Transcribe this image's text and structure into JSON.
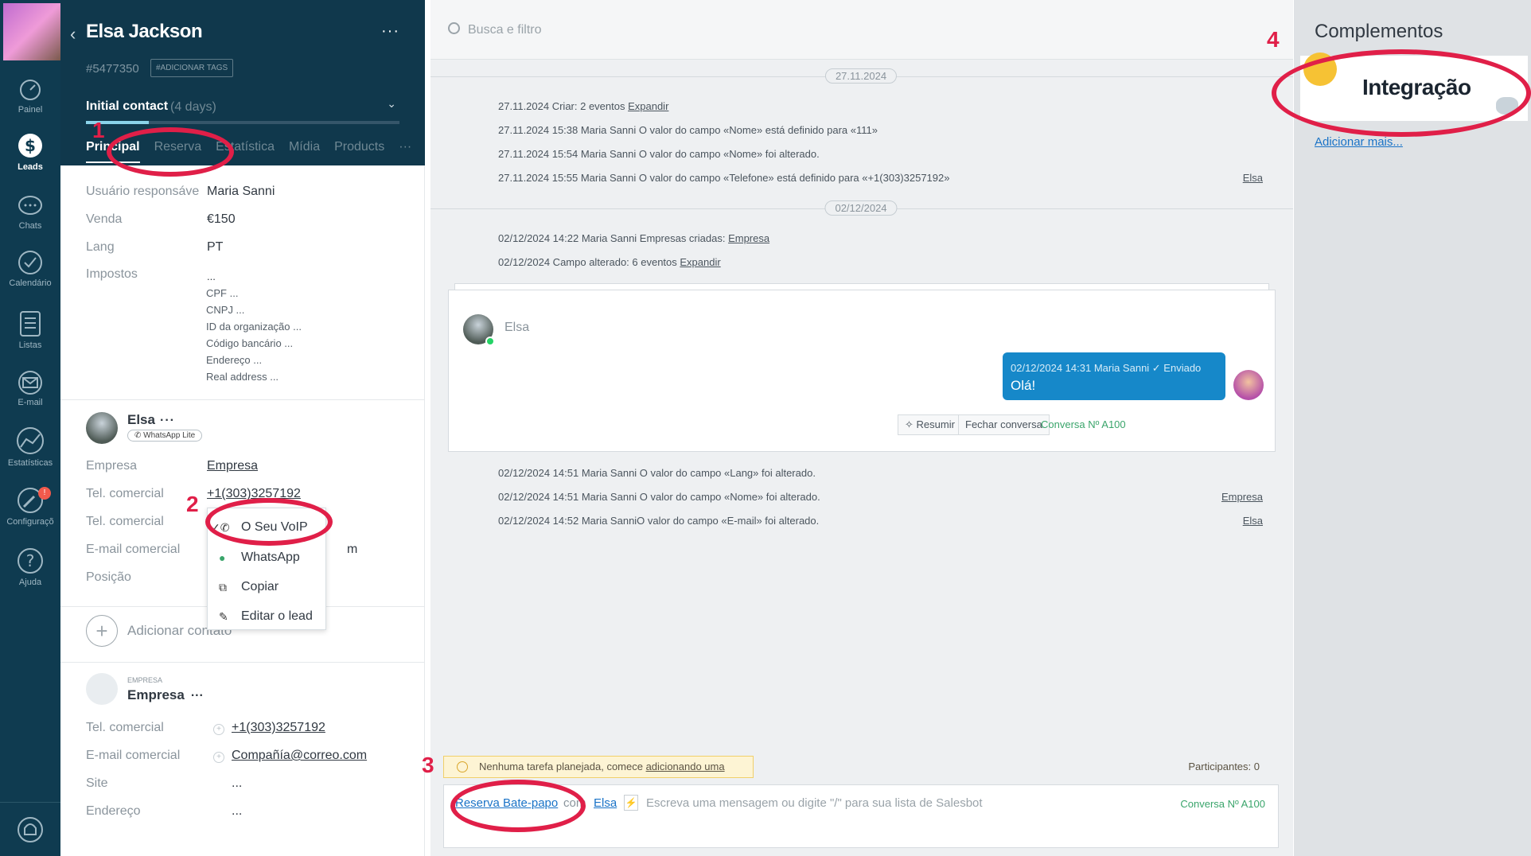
{
  "nav": {
    "items": [
      {
        "label": "Painel",
        "icon": "dashboard-icon"
      },
      {
        "label": "Leads",
        "icon": "leads-icon",
        "active": true
      },
      {
        "label": "Chats",
        "icon": "chat-icon"
      },
      {
        "label": "Calendário",
        "icon": "check-icon"
      },
      {
        "label": "Listas",
        "icon": "list-icon"
      },
      {
        "label": "E-mail",
        "icon": "mail-icon"
      },
      {
        "label": "Estatísticas",
        "icon": "stats-icon"
      },
      {
        "label": "Configuraçõ",
        "icon": "settings-icon",
        "badge": "!"
      },
      {
        "label": "Ajuda",
        "icon": "help-icon"
      }
    ]
  },
  "lead": {
    "name": "Elsa Jackson",
    "more": "···",
    "id": "#5477350",
    "add_tags": "#ADICIONAR TAGS",
    "stage": "Initial contact",
    "stage_days": "(4 days)",
    "stage_progress": 0.2,
    "tabs": [
      "Principal",
      "Reserva",
      "Estatística",
      "Mídia",
      "Products",
      "···"
    ],
    "fields": [
      {
        "label": "Usuário responsáve",
        "value": "Maria Sanni"
      },
      {
        "label": "Venda",
        "value": "€150"
      },
      {
        "label": "Lang",
        "value": "PT"
      },
      {
        "label": "Impostos",
        "value": "..."
      }
    ],
    "tax_list": [
      "CPF ...",
      "CNPJ ...",
      "ID da organização ...",
      "Código bancário ...",
      "Endereço ...",
      "Real address ..."
    ]
  },
  "contact": {
    "name": "Elsa",
    "more": "···",
    "chip": "WhatsApp Lite",
    "fields": [
      {
        "label": "Empresa",
        "value": "Empresa"
      },
      {
        "label": "Tel. comercial",
        "value": "+1(303)3257192"
      },
      {
        "label": "Tel. comercial",
        "value": ""
      },
      {
        "label": "E-mail comercial",
        "value": "m"
      },
      {
        "label": "Posição",
        "value": ""
      }
    ],
    "add_label": "Adicionar contato"
  },
  "menu": {
    "items": [
      {
        "label": "O Seu VoIP",
        "icon": "✓📞"
      },
      {
        "label": "WhatsApp",
        "icon": "●"
      },
      {
        "label": "Copiar",
        "icon": "⧉"
      },
      {
        "label": "Editar o lead",
        "icon": "✎"
      }
    ]
  },
  "company": {
    "kind": "EMPRESA",
    "name": "Empresa",
    "more": "···",
    "fields": [
      {
        "label": "Tel. comercial",
        "value": "+1(303)3257192"
      },
      {
        "label": "E-mail comercial",
        "value": "Compañía@correo.com"
      },
      {
        "label": "Site",
        "value": "..."
      },
      {
        "label": "Endereço",
        "value": "..."
      }
    ]
  },
  "feed": {
    "search_placeholder": "Busca e filtro",
    "date1": "27.11.2024",
    "date2": "02/12/2024",
    "events1": [
      {
        "text": "27.11.2024 Criar: 2 eventos ",
        "link": "Expandir"
      },
      {
        "text": "27.11.2024 15:38 Maria Sanni O valor do campo «Nome» está definido para «111»",
        "link": ""
      },
      {
        "text": "27.11.2024 15:54 Maria Sanni O valor do campo «Nome» foi alterado.",
        "link": ""
      },
      {
        "text": "27.11.2024 15:55 Maria Sanni O valor do campo «Telefone» está definido para «+1(303)3257192»",
        "link": "",
        "right": "Elsa"
      }
    ],
    "events2": [
      {
        "text": "02/12/2024 14:22 Maria Sanni Empresas criadas: ",
        "link": "Empresa"
      },
      {
        "text": "02/12/2024 Campo alterado: 6 eventos ",
        "link": "Expandir"
      }
    ],
    "chat": {
      "from": "Elsa",
      "bubble_meta": "02/12/2024 14:31 Maria Sanni ✓ Enviado",
      "bubble_text": "Olá!",
      "btn_summarize": "Resumir",
      "btn_close": "Fechar conversa",
      "conversation": "Conversa Nº A100"
    },
    "events3": [
      {
        "text": "02/12/2024 14:51 Maria Sanni O valor do campo «Lang» foi alterado.",
        "right": ""
      },
      {
        "text": "02/12/2024 14:51 Maria Sanni O valor do campo «Nome» foi alterado.",
        "right": "Empresa"
      },
      {
        "text": "02/12/2024 14:52 Maria SanniO valor do campo «E-mail» foi alterado.",
        "right": "Elsa"
      }
    ],
    "task_warning": "Nenhuma tarefa planejada, comece ",
    "task_link": "adicionando uma",
    "participants": "Participantes: 0",
    "composer": {
      "reserve_link": "Reserva Bate-papo",
      "with": "com",
      "contact_link": "Elsa",
      "colon": ":",
      "placeholder": "Escreva uma mensagem ou digite \"/\" para sua lista de Salesbot",
      "conversation": "Conversa Nº A100"
    }
  },
  "right_panel": {
    "title": "Complementos",
    "card_title": "Integração",
    "more_link": "Adicionar mais..."
  },
  "annotations": [
    "1",
    "2",
    "3",
    "4"
  ],
  "colors": {
    "sidebar_dark": "#0f3b50",
    "lead_header": "#10384c",
    "accent_blue": "#1688c9",
    "annotation_red": "#e01f48",
    "whatsapp_green": "#3aa56b"
  }
}
